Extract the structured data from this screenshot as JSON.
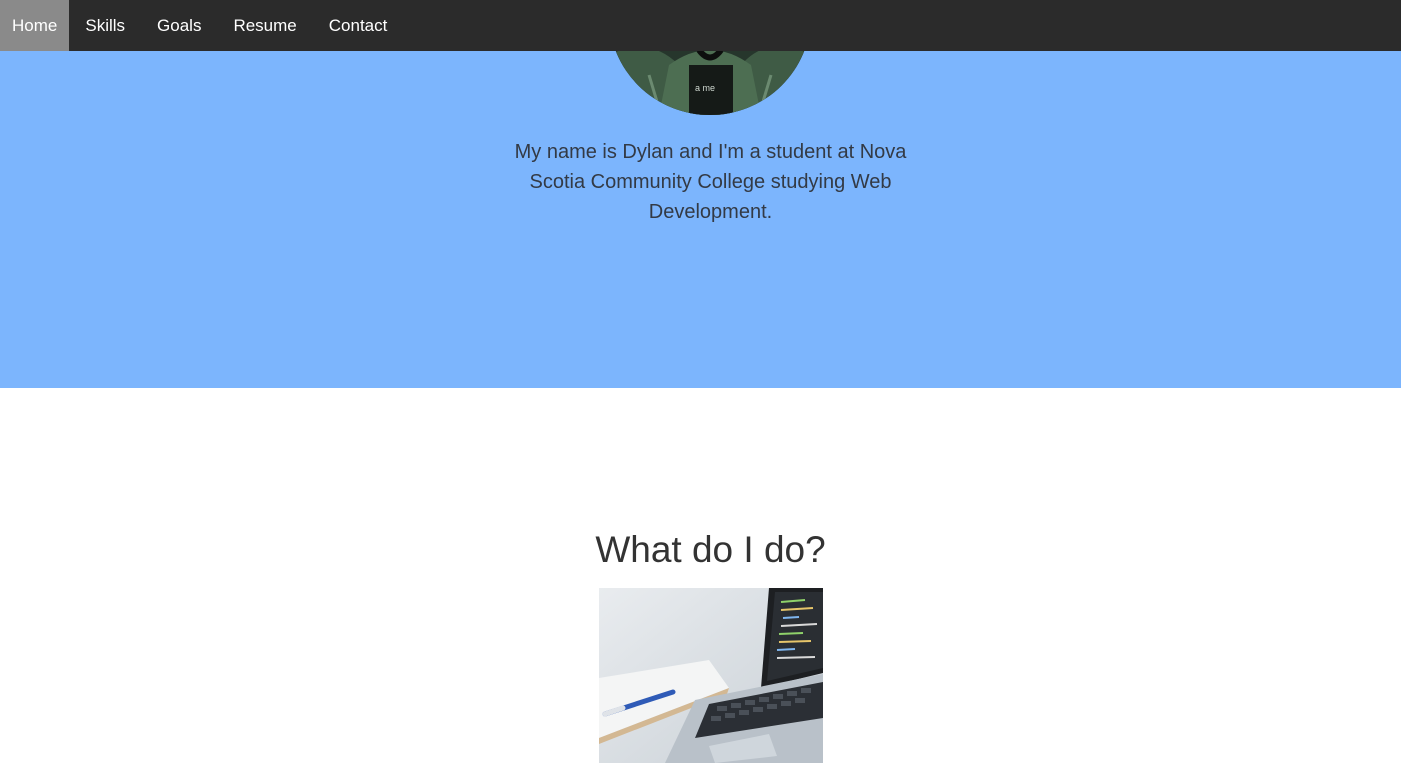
{
  "nav": {
    "items": [
      {
        "label": "Home",
        "active": true
      },
      {
        "label": "Skills",
        "active": false
      },
      {
        "label": "Goals",
        "active": false
      },
      {
        "label": "Resume",
        "active": false
      },
      {
        "label": "Contact",
        "active": false
      }
    ]
  },
  "hero": {
    "intro_text": "My name is Dylan and I'm a student at Nova Scotia Community College studying Web Development.",
    "background_color": "#7cb5fd"
  },
  "what_i_do": {
    "title": "What do I do?"
  },
  "colors": {
    "navbar": "#2b2b2b",
    "nav_active": "#8a8a8a",
    "text_dark": "#333333"
  }
}
